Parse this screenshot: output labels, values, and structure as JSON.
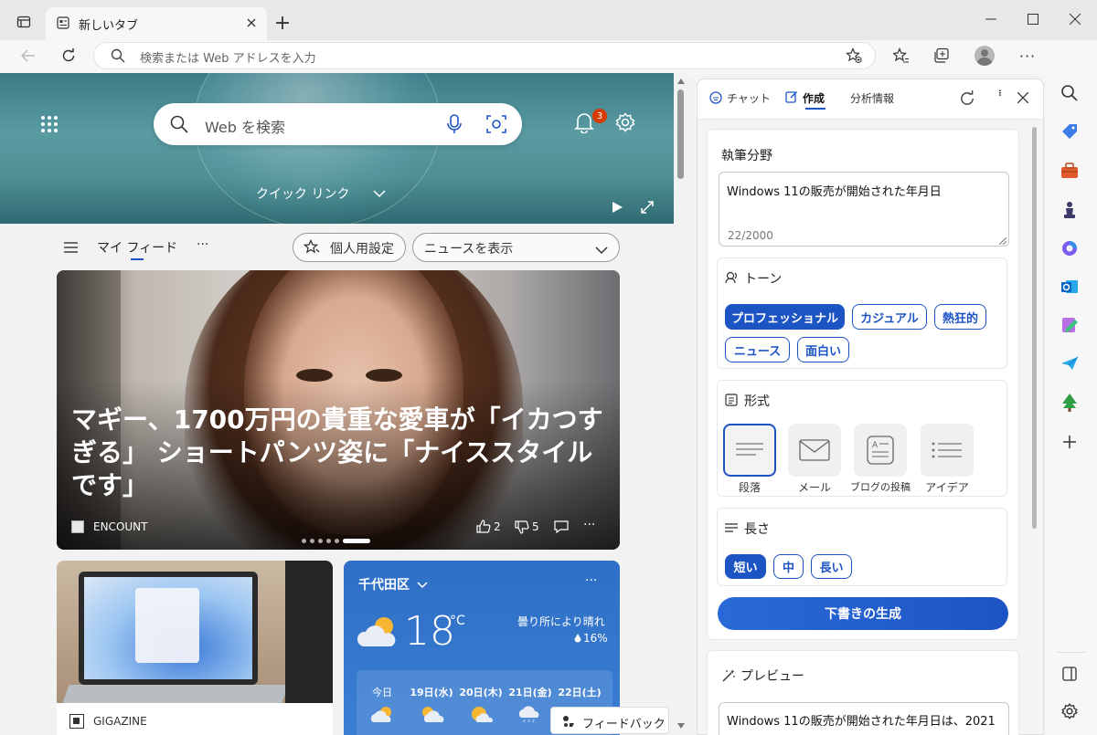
{
  "tab": {
    "title": "新しいタブ",
    "new_tab_label": "+"
  },
  "address": {
    "placeholder": "検索または Web アドレスを入力"
  },
  "ntp": {
    "search_placeholder": "Web を検索",
    "notification_count": "3",
    "quick_links": "クイック リンク",
    "feed_title": "マイ フィード",
    "more_dots": "···",
    "personalize": "個人用設定",
    "show_news": "ニュースを表示",
    "feedback": "フィードバック"
  },
  "main_story": {
    "headline": "マギー、1700万円の貴重な愛車が「イカつすぎる」 ショートパンツ姿に「ナイススタイルです」",
    "source": "ENCOUNT",
    "likes": "2",
    "dislikes": "5"
  },
  "laptop_card": {
    "source": "GIGAZINE"
  },
  "weather": {
    "location": "千代田区",
    "temp": "18",
    "unit": "°C",
    "condition": "曇り所により晴れ",
    "precip": "16%",
    "days": [
      "今日",
      "19日(水)",
      "20日(木)",
      "21日(金)",
      "22日(土)"
    ]
  },
  "panel": {
    "tabs": [
      "チャット",
      "作成",
      "分析情報"
    ],
    "active_tab": "作成",
    "topic_label": "執筆分野",
    "topic_value": "Windows 11の販売が開始された年月日",
    "char_count": "22/2000",
    "tone_label": "トーン",
    "tones": [
      "プロフェッショナル",
      "カジュアル",
      "熱狂的",
      "ニュース",
      "面白い"
    ],
    "selected_tone": "プロフェッショナル",
    "format_label": "形式",
    "formats": [
      "段落",
      "メール",
      "ブログの投稿",
      "アイデア"
    ],
    "selected_format": "段落",
    "length_label": "長さ",
    "lengths": [
      "短い",
      "中",
      "長い"
    ],
    "selected_length": "短い",
    "generate_button": "下書きの生成",
    "preview_label": "プレビュー",
    "preview_text": "Windows 11の販売が開始された年月日は、2021"
  },
  "colors": {
    "accent": "#1d54c4",
    "weather_bg": "#2f6fc7",
    "badge": "#d83b01"
  }
}
